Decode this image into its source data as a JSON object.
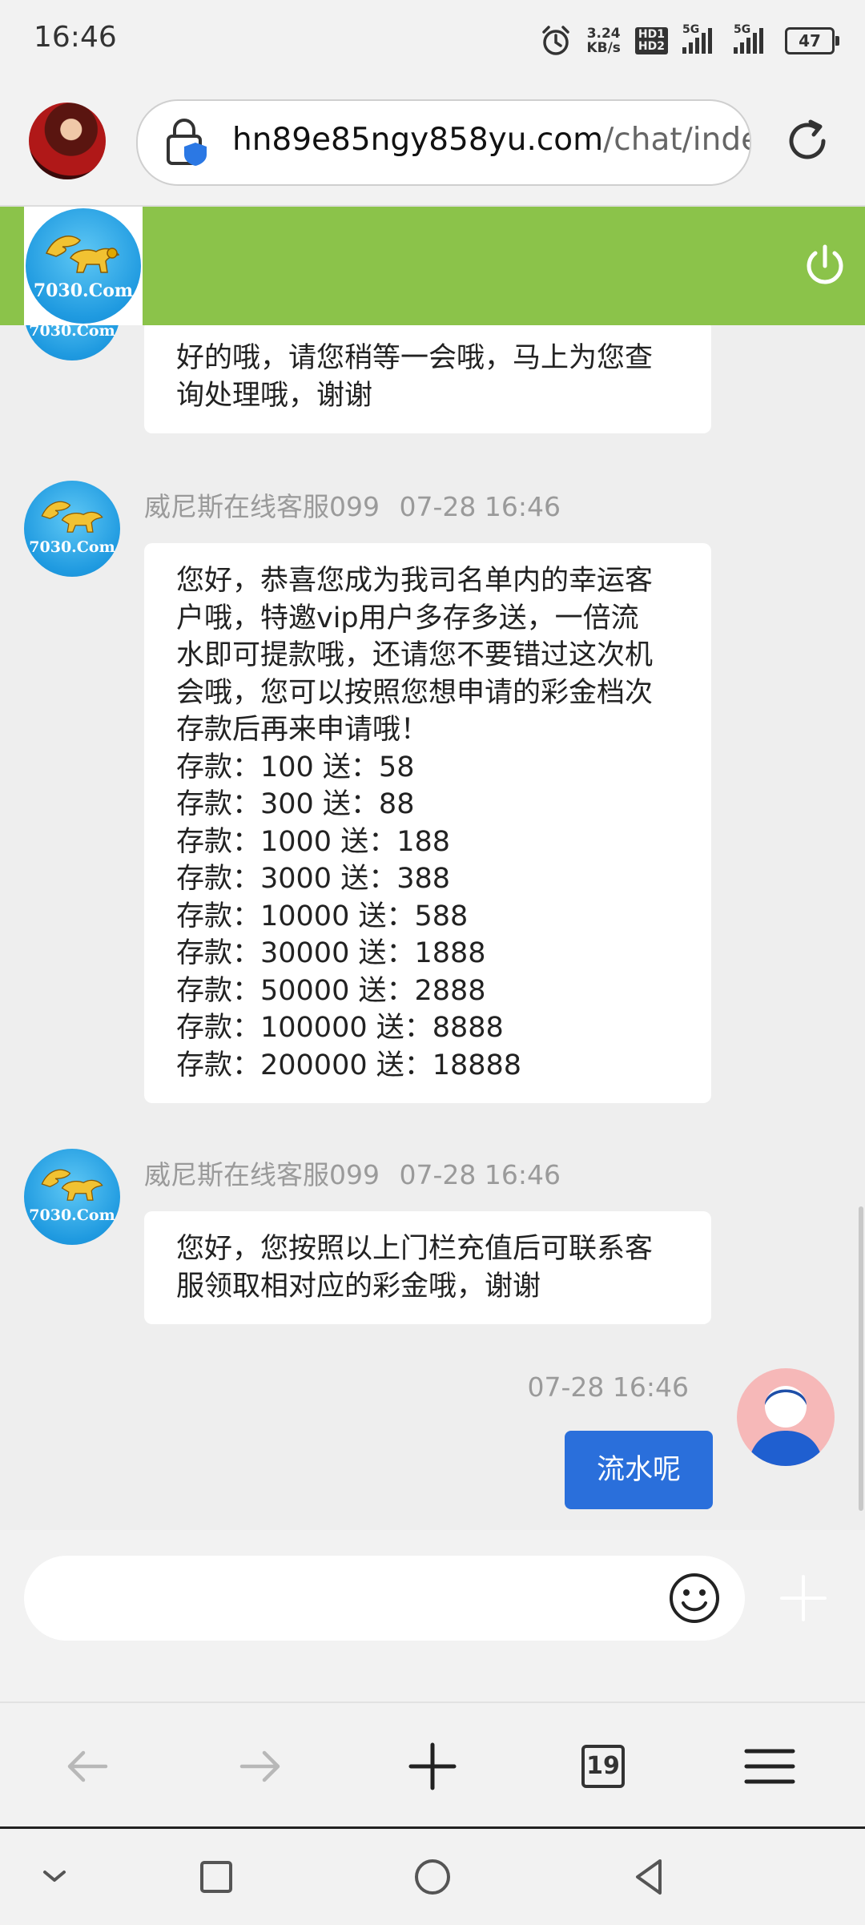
{
  "status_bar": {
    "time": "16:46",
    "net_speed_value": "3.24",
    "net_speed_unit": "KB/s",
    "hd1": "HD1",
    "hd2": "HD2",
    "sim1": "5G",
    "sim2": "5G",
    "battery": "47"
  },
  "browser": {
    "url_domain": "hn89e85ngy858yu.com",
    "url_path": "/chat/inde"
  },
  "brand": {
    "logo_text": "7030.Com",
    "header_color": "#8bc34a"
  },
  "messages": [
    {
      "lines": [
        "好的哦，请您稍等一会哦，马上为您查",
        "询处理哦，谢谢"
      ]
    },
    {
      "sender": "威尼斯在线客服099",
      "time": "07-28 16:46",
      "lines": [
        "您好，恭喜您成为我司名单内的幸运客",
        "户哦，特邀vip用户多存多送，一倍流",
        "水即可提款哦，还请您不要错过这次机",
        "会哦，您可以按照您想申请的彩金档次",
        "存款后再来申请哦！",
        "存款：100 送：58",
        "存款：300 送：88",
        "存款：1000 送：188",
        "存款：3000 送：388",
        "存款：10000 送：588",
        "存款：30000 送：1888",
        "存款：50000 送：2888",
        "存款：100000 送：8888",
        "存款：200000 送：18888"
      ]
    },
    {
      "sender": "威尼斯在线客服099",
      "time": "07-28 16:46",
      "lines": [
        "您好，您按照以上门栏充值后可联系客",
        "服领取相对应的彩金哦，谢谢"
      ]
    }
  ],
  "my_message": {
    "time": "07-28 16:46",
    "text": "流水呢"
  },
  "input": {
    "placeholder": ""
  },
  "toolbar": {
    "tabs_count": "19"
  }
}
